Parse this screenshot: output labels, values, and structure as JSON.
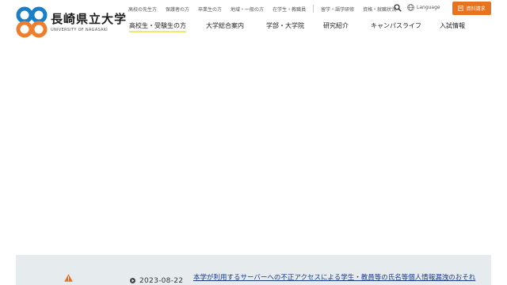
{
  "logo": {
    "title": "長崎県立大学",
    "subtitle": "UNIVERSITY OF NAGASAKI",
    "colors": {
      "blue": "#1a7fc4",
      "orange": "#ee7d2c"
    }
  },
  "utility_nav": [
    "高校の先生方",
    "保護者の方",
    "卒業生の方",
    "地域・一般の方",
    "在学生・教職員",
    "留学・語学研修",
    "資格・就職状況"
  ],
  "language_label": "Language",
  "request_button": "資料請求",
  "main_nav": [
    "高校生・受験生の方",
    "大学総合案内",
    "学部・大学院",
    "研究紹介",
    "キャンパスライフ",
    "入試情報"
  ],
  "notice": {
    "date": "2023-08-22",
    "text": "本学が利用するサーバーへの不正アクセスによる学生・教員等の氏名等個人情報漏洩のおそれ"
  },
  "colors": {
    "accent": "#e8731f",
    "nav_underline": "#f2e86d",
    "notice_bg": "#e6ebee",
    "link": "#1a3a8a"
  }
}
